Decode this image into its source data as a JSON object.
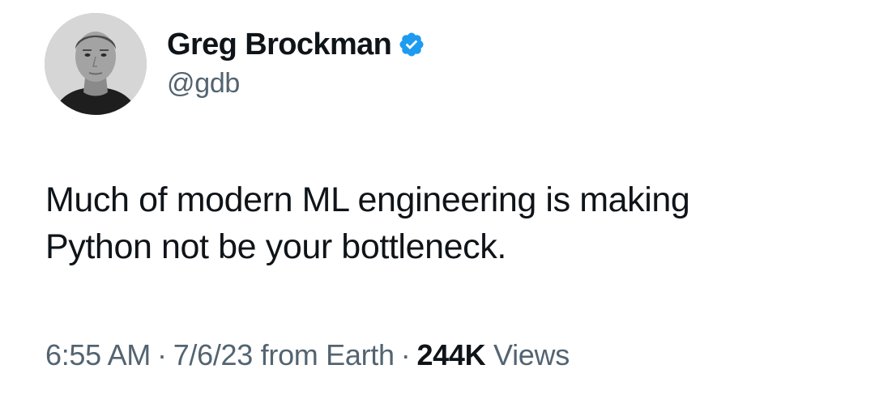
{
  "author": {
    "display_name": "Greg Brockman",
    "handle": "@gdb",
    "verified": true,
    "verified_color": "#1d9bf0"
  },
  "tweet": {
    "text_lines": [
      "Much of modern ML engineering is making",
      "Python not be your bottleneck."
    ]
  },
  "meta": {
    "time": "6:55 AM",
    "separator": "·",
    "date_source": "7/6/23 from Earth",
    "views_count": "244K",
    "views_label": "Views"
  },
  "icons": {
    "avatar": "profile-photo",
    "verified": "verified-badge-icon"
  },
  "colors": {
    "text_primary": "#0f1419",
    "text_secondary": "#536471",
    "background": "#ffffff"
  }
}
